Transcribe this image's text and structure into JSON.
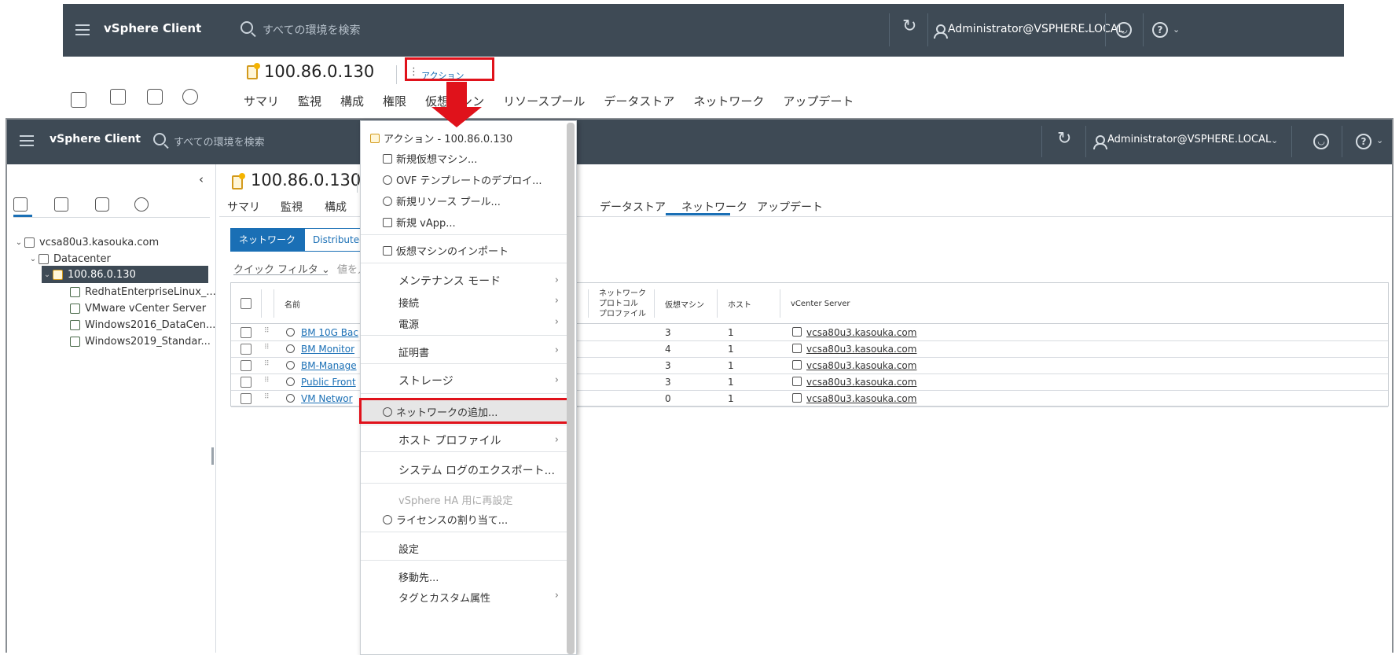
{
  "top": {
    "app_title": "vSphere Client",
    "search_placeholder": "すべての環境を検索",
    "user": "Administrator@VSPHERE.LOCAL",
    "object_title": "100.86.0.130",
    "action_label": "アクション",
    "tabs": [
      "サマリ",
      "監視",
      "構成",
      "権限",
      "仮想マシン",
      "リソースプール",
      "データストア",
      "ネットワーク",
      "アップデート"
    ]
  },
  "main": {
    "app_title": "vSphere Client",
    "search_placeholder": "すべての環境を検索",
    "user": "Administrator@VSPHERE.LOCAL",
    "object_title": "100.86.0.130",
    "tabs": [
      "サマリ",
      "監視",
      "構成",
      "データストア",
      "ネットワーク",
      "アップデート"
    ],
    "sub_tabs": [
      "ネットワーク",
      "Distributed S"
    ],
    "quick_filter": "クイック フィルタ",
    "filter_value": "値を入",
    "tree": [
      {
        "label": "vcsa80u3.kasouka.com"
      },
      {
        "label": "Datacenter"
      },
      {
        "label": "100.86.0.130"
      },
      {
        "label": "RedhatEnterpriseLinux_..."
      },
      {
        "label": "VMware vCenter Server"
      },
      {
        "label": "Windows2016_DataCen..."
      },
      {
        "label": "Windows2019_Standar..."
      }
    ],
    "grid": {
      "headers": {
        "name": "名前",
        "protocol": "ネットワーク\nプロトコル\nプロファイル",
        "vms": "仮想マシン",
        "hosts": "ホスト",
        "vcenter": "vCenter Server"
      },
      "rows": [
        {
          "name": "BM 10G Bac",
          "vms": "3",
          "hosts": "1",
          "vcenter": "vcsa80u3.kasouka.com"
        },
        {
          "name": "BM Monitor",
          "vms": "4",
          "hosts": "1",
          "vcenter": "vcsa80u3.kasouka.com"
        },
        {
          "name": "BM-Manage",
          "vms": "3",
          "hosts": "1",
          "vcenter": "vcsa80u3.kasouka.com"
        },
        {
          "name": "Public Front",
          "vms": "3",
          "hosts": "1",
          "vcenter": "vcsa80u3.kasouka.com"
        },
        {
          "name": "VM Networ",
          "vms": "0",
          "hosts": "1",
          "vcenter": "vcsa80u3.kasouka.com"
        }
      ]
    }
  },
  "menu": {
    "header": "アクション - 100.86.0.130",
    "items": {
      "new_vm": "新規仮想マシン...",
      "ovf": "OVF テンプレートのデプロイ...",
      "new_pool": "新規リソース プール...",
      "new_vapp": "新規 vApp...",
      "import_vm": "仮想マシンのインポート",
      "maintenance": "メンテナンス モード",
      "connection": "接続",
      "power": "電源",
      "certificates": "証明書",
      "storage": "ストレージ",
      "add_network": "ネットワークの追加...",
      "host_profile": "ホスト プロファイル",
      "export_logs": "システム ログのエクスポート...",
      "reconfigure_ha": "vSphere HA 用に再設定",
      "assign_license": "ライセンスの割り当て...",
      "settings": "設定",
      "move_to": "移動先...",
      "tags": "タグとカスタム属性"
    }
  },
  "colors": {
    "header_bg": "#3e4a55",
    "accent": "#1a6fb5",
    "highlight_red": "#e0121b"
  }
}
